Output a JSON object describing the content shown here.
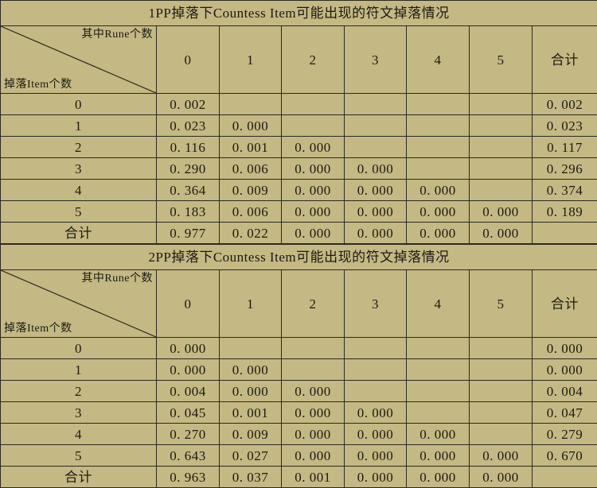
{
  "page": {
    "background_color": "#c4b884",
    "border_color": "#2b2a20",
    "text_color": "#1c1a12"
  },
  "tables": [
    {
      "title": "1PP掉落下Countess Item可能出现的符文掉落情况",
      "corner": {
        "top_label": "其中Rune个数",
        "bottom_label": "掉落Item个数"
      },
      "column_headers": [
        "0",
        "1",
        "2",
        "3",
        "4",
        "5",
        "合计"
      ],
      "rows": [
        {
          "header": "0",
          "values": [
            "0. 002",
            "",
            "",
            "",
            "",
            "",
            "0. 002"
          ]
        },
        {
          "header": "1",
          "values": [
            "0. 023",
            "0. 000",
            "",
            "",
            "",
            "",
            "0. 023"
          ]
        },
        {
          "header": "2",
          "values": [
            "0. 116",
            "0. 001",
            "0. 000",
            "",
            "",
            "",
            "0. 117"
          ]
        },
        {
          "header": "3",
          "values": [
            "0. 290",
            "0. 006",
            "0. 000",
            "0. 000",
            "",
            "",
            "0. 296"
          ]
        },
        {
          "header": "4",
          "values": [
            "0. 364",
            "0. 009",
            "0. 000",
            "0. 000",
            "0. 000",
            "",
            "0. 374"
          ]
        },
        {
          "header": "5",
          "values": [
            "0. 183",
            "0. 006",
            "0. 000",
            "0. 000",
            "0. 000",
            "0. 000",
            "0. 189"
          ]
        },
        {
          "header": "合计",
          "values": [
            "0. 977",
            "0. 022",
            "0. 000",
            "0. 000",
            "0. 000",
            "0. 000",
            ""
          ]
        }
      ]
    },
    {
      "title": "2PP掉落下Countess Item可能出现的符文掉落情况",
      "corner": {
        "top_label": "其中Rune个数",
        "bottom_label": "掉落Item个数"
      },
      "column_headers": [
        "0",
        "1",
        "2",
        "3",
        "4",
        "5",
        "合计"
      ],
      "rows": [
        {
          "header": "0",
          "values": [
            "0. 000",
            "",
            "",
            "",
            "",
            "",
            "0. 000"
          ]
        },
        {
          "header": "1",
          "values": [
            "0. 000",
            "0. 000",
            "",
            "",
            "",
            "",
            "0. 000"
          ]
        },
        {
          "header": "2",
          "values": [
            "0. 004",
            "0. 000",
            "0. 000",
            "",
            "",
            "",
            "0. 004"
          ]
        },
        {
          "header": "3",
          "values": [
            "0. 045",
            "0. 001",
            "0. 000",
            "0. 000",
            "",
            "",
            "0. 047"
          ]
        },
        {
          "header": "4",
          "values": [
            "0. 270",
            "0. 009",
            "0. 000",
            "0. 000",
            "0. 000",
            "",
            "0. 279"
          ]
        },
        {
          "header": "5",
          "values": [
            "0. 643",
            "0. 027",
            "0. 000",
            "0. 000",
            "0. 000",
            "0. 000",
            "0. 670"
          ]
        },
        {
          "header": "合计",
          "values": [
            "0. 963",
            "0. 037",
            "0. 001",
            "0. 000",
            "0. 000",
            "0. 000",
            ""
          ]
        }
      ]
    }
  ],
  "chart_data": {
    "type": "table",
    "title": "Countess Item 符文掉落概率分布表",
    "tables": [
      {
        "title": "1PP掉落下Countess Item可能出现的符文掉落情况",
        "row_axis_label": "掉落Item个数",
        "col_axis_label": "其中Rune个数",
        "categories": [
          "0",
          "1",
          "2",
          "3",
          "4",
          "5",
          "合计"
        ],
        "rows": [
          "0",
          "1",
          "2",
          "3",
          "4",
          "5",
          "合计"
        ],
        "values": [
          [
            0.002,
            null,
            null,
            null,
            null,
            null,
            0.002
          ],
          [
            0.023,
            0.0,
            null,
            null,
            null,
            null,
            0.023
          ],
          [
            0.116,
            0.001,
            0.0,
            null,
            null,
            null,
            0.117
          ],
          [
            0.29,
            0.006,
            0.0,
            0.0,
            null,
            null,
            0.296
          ],
          [
            0.364,
            0.009,
            0.0,
            0.0,
            0.0,
            null,
            0.374
          ],
          [
            0.183,
            0.006,
            0.0,
            0.0,
            0.0,
            0.0,
            0.189
          ],
          [
            0.977,
            0.022,
            0.0,
            0.0,
            0.0,
            0.0,
            null
          ]
        ]
      },
      {
        "title": "2PP掉落下Countess Item可能出现的符文掉落情况",
        "row_axis_label": "掉落Item个数",
        "col_axis_label": "其中Rune个数",
        "categories": [
          "0",
          "1",
          "2",
          "3",
          "4",
          "5",
          "合计"
        ],
        "rows": [
          "0",
          "1",
          "2",
          "3",
          "4",
          "5",
          "合计"
        ],
        "values": [
          [
            0.0,
            null,
            null,
            null,
            null,
            null,
            0.0
          ],
          [
            0.0,
            0.0,
            null,
            null,
            null,
            null,
            0.0
          ],
          [
            0.004,
            0.0,
            0.0,
            null,
            null,
            null,
            0.004
          ],
          [
            0.045,
            0.001,
            0.0,
            0.0,
            null,
            null,
            0.047
          ],
          [
            0.27,
            0.009,
            0.0,
            0.0,
            0.0,
            null,
            0.279
          ],
          [
            0.643,
            0.027,
            0.0,
            0.0,
            0.0,
            0.0,
            0.67
          ],
          [
            0.963,
            0.037,
            0.001,
            0.0,
            0.0,
            0.0,
            null
          ]
        ]
      }
    ]
  }
}
